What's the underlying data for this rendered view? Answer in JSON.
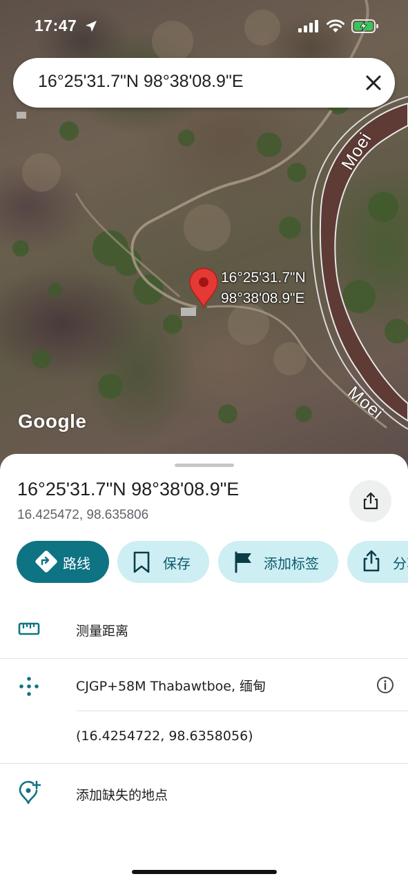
{
  "status_bar": {
    "time": "17:47"
  },
  "search": {
    "query": "16°25'31.7\"N 98°38'08.9\"E"
  },
  "map": {
    "pin_label_line1": "16°25'31.7\"N",
    "pin_label_line2": "98°38'08.9\"E",
    "river_label_top": "Moei",
    "river_label_bottom": "Moei",
    "logo": "Google"
  },
  "place": {
    "title": "16°25'31.7\"N 98°38'08.9\"E",
    "coordinates": "16.425472, 98.635806"
  },
  "actions": {
    "route": "路线",
    "save": "保存",
    "add_label": "添加标签",
    "share": "分享"
  },
  "rows": {
    "measure": "测量距离",
    "plus_code": "CJGP+58M Thabawtboe, 缅甸",
    "decimal_coords": "(16.4254722, 98.6358056)",
    "add_place": "添加缺失的地点"
  },
  "colors": {
    "accent": "#0e7383",
    "chip_bg": "#cdeef3",
    "pin": "#e53935"
  }
}
